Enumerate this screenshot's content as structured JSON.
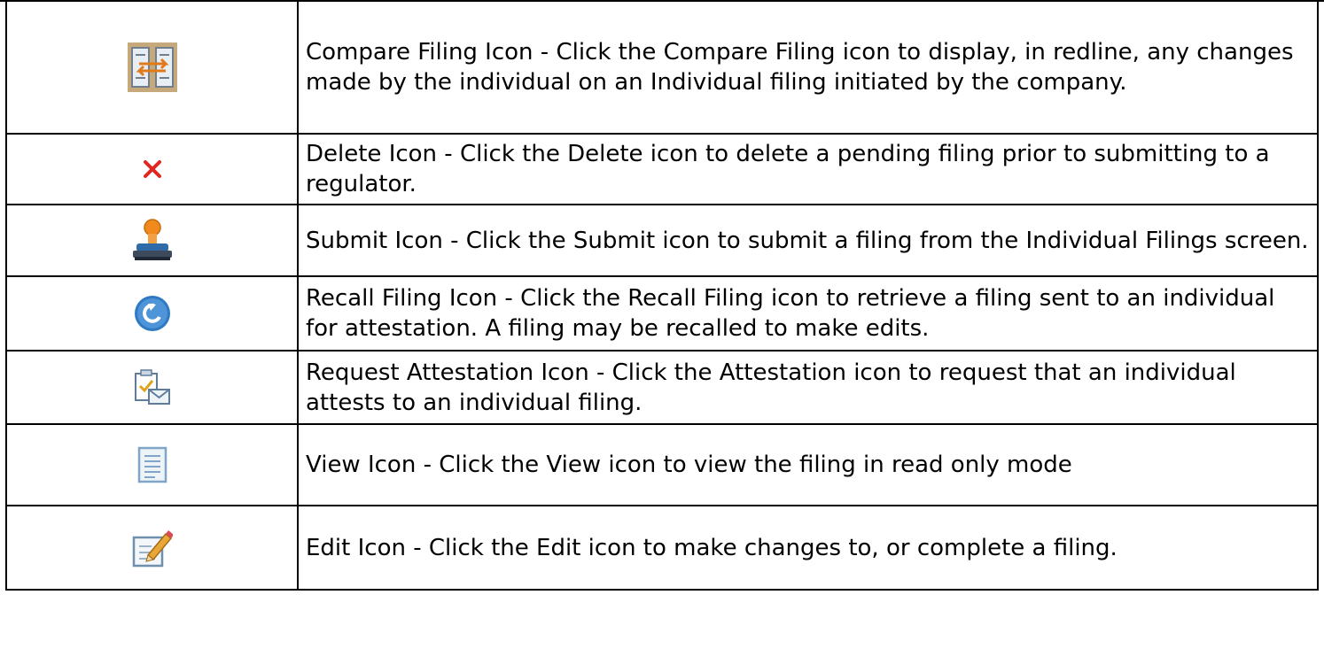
{
  "rows": [
    {
      "icon": "compare-filing-icon",
      "text": "Compare Filing Icon - Click the Compare Filing icon to display, in redline, any changes made by the individual on an Individual filing initiated by the company."
    },
    {
      "icon": "delete-icon",
      "text": "Delete Icon - Click the Delete icon to delete a pending filing prior to submitting to a regulator."
    },
    {
      "icon": "submit-stamp-icon",
      "text": "Submit Icon - Click the Submit icon to submit a filing from the Individual Filings screen."
    },
    {
      "icon": "recall-filing-icon",
      "text": "Recall Filing Icon - Click the Recall Filing icon to retrieve a filing sent to an individual for attestation. A filing may be recalled to make edits."
    },
    {
      "icon": "request-attestation-icon",
      "text": "Request Attestation Icon - Click the Attestation icon to request that an individual attests to an individual filing."
    },
    {
      "icon": "view-icon",
      "text": "View Icon - Click the View icon to view the filing in read only mode"
    },
    {
      "icon": "edit-icon",
      "text": "Edit Icon - Click the Edit icon to make changes to, or complete a filing."
    }
  ],
  "colors": {
    "border": "#000000",
    "compare_bg": "#c6a97a",
    "delete_red": "#e0261f",
    "stamp_orange": "#f08a1c",
    "recall_blue": "#2f79c2",
    "paper_blue": "#7fa6c8"
  }
}
